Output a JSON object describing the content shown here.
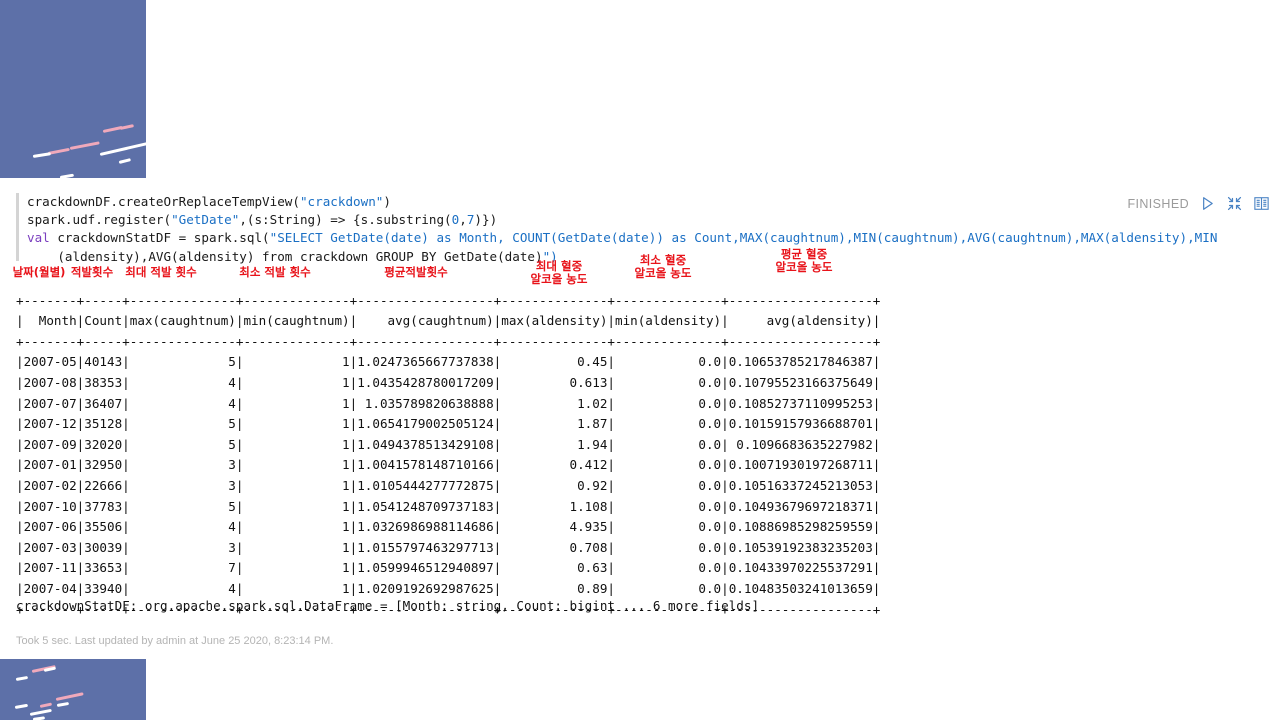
{
  "notebook": {
    "code_lines": [
      "crackdownDF.createOrReplaceTempView(\"crackdown\")",
      "spark.udf.register(\"GetDate\",(s:String) => {s.substring(0,7)})",
      "val crackdownStatDF = spark.sql(\"SELECT GetDate(date) as Month, COUNT(GetDate(date)) as Count,MAX(caughtnum),MIN(caughtnum),AVG(caughtnum),MAX(aldensity),MIN",
      "    (aldensity),AVG(aldensity) from crackdown GROUP BY GetDate(date)\")"
    ],
    "status_label": "FINISHED",
    "icons": [
      "run-icon",
      "collapse-icon",
      "book-icon"
    ],
    "result_line": "crackdownStatDF: org.apache.spark.sql.DataFrame = [Month: string, Count: bigint ... 6 more fields]",
    "footer": "Took 5 sec. Last updated by admin at June 25 2020, 8:23:14 PM."
  },
  "table": {
    "rule": "+-------+-----+--------------+--------------+------------------+--------------+--------------+-------------------+",
    "header": "|  Month|Count|max(caughtnum)|min(caughtnum)|    avg(caughtnum)|max(aldensity)|min(aldensity)|     avg(aldensity)|",
    "columns": [
      "Month",
      "Count",
      "max(caughtnum)",
      "min(caughtnum)",
      "avg(caughtnum)",
      "max(aldensity)",
      "min(aldensity)",
      "avg(aldensity)"
    ],
    "rows": [
      [
        "2007-05",
        "40143",
        "5",
        "1",
        "1.0247365667737838",
        "0.45",
        "0.0",
        "0.10653785217846387"
      ],
      [
        "2007-08",
        "38353",
        "4",
        "1",
        "1.0435428780017209",
        "0.613",
        "0.0",
        "0.10795523166375649"
      ],
      [
        "2007-07",
        "36407",
        "4",
        "1",
        "1.035789820638888",
        "1.02",
        "0.0",
        "0.10852737110995253"
      ],
      [
        "2007-12",
        "35128",
        "5",
        "1",
        "1.0654179002505124",
        "1.87",
        "0.0",
        "0.10159157936688701"
      ],
      [
        "2007-09",
        "32020",
        "5",
        "1",
        "1.0494378513429108",
        "1.94",
        "0.0",
        "0.1096683635227982"
      ],
      [
        "2007-01",
        "32950",
        "3",
        "1",
        "1.0041578148710166",
        "0.412",
        "0.0",
        "0.10071930197268711"
      ],
      [
        "2007-02",
        "22666",
        "3",
        "1",
        "1.0105444277772875",
        "0.92",
        "0.0",
        "0.10516337245213053"
      ],
      [
        "2007-10",
        "37783",
        "5",
        "1",
        "1.0541248709737183",
        "1.108",
        "0.0",
        "0.10493679697218371"
      ],
      [
        "2007-06",
        "35506",
        "4",
        "1",
        "1.0326986988114686",
        "4.935",
        "0.0",
        "0.10886985298259559"
      ],
      [
        "2007-03",
        "30039",
        "3",
        "1",
        "1.0155797463297713",
        "0.708",
        "0.0",
        "0.10539192383235203"
      ],
      [
        "2007-11",
        "33653",
        "7",
        "1",
        "1.0599946512940897",
        "0.63",
        "0.0",
        "0.10433970225537291"
      ],
      [
        "2007-04",
        "33940",
        "4",
        "1",
        "1.0209192692987625",
        "0.89",
        "0.0",
        "0.10483503241013659"
      ]
    ],
    "rendered": "+-------+-----+--------------+--------------+------------------+--------------+--------------+-------------------+\n|  Month|Count|max(caughtnum)|min(caughtnum)|    avg(caughtnum)|max(aldensity)|min(aldensity)|     avg(aldensity)|\n+-------+-----+--------------+--------------+------------------+--------------+--------------+-------------------+\n|2007-05|40143|             5|             1|1.0247365667737838|          0.45|           0.0|0.10653785217846387|\n|2007-08|38353|             4|             1|1.0435428780017209|         0.613|           0.0|0.10795523166375649|\n|2007-07|36407|             4|             1| 1.035789820638888|          1.02|           0.0|0.10852737110995253|\n|2007-12|35128|             5|             1|1.0654179002505124|          1.87|           0.0|0.10159157936688701|\n|2007-09|32020|             5|             1|1.0494378513429108|          1.94|           0.0| 0.1096683635227982|\n|2007-01|32950|             3|             1|1.0041578148710166|         0.412|           0.0|0.10071930197268711|\n|2007-02|22666|             3|             1|1.0105444277772875|          0.92|           0.0|0.10516337245213053|\n|2007-10|37783|             5|             1|1.0541248709737183|         1.108|           0.0|0.10493679697218371|\n|2007-06|35506|             4|             1|1.0326986988114686|         4.935|           0.0|0.10886985298259559|\n|2007-03|30039|             3|             1|1.0155797463297713|         0.708|           0.0|0.10539192383235203|\n|2007-11|33653|             7|             1|1.0599946512940897|          0.63|           0.0|0.10433970225537291|\n|2007-04|33940|             4|             1|1.0209192692987625|          0.89|           0.0|0.10483503241013659|\n+-------+-----+--------------+--------------+------------------+--------------+--------------+-------------------+"
  },
  "annotations": {
    "color": "#e8131a",
    "items": [
      {
        "text": "날짜(월별)",
        "target_column": "Month"
      },
      {
        "text": "적발횟수",
        "target_column": "Count"
      },
      {
        "text": "최대 적발 횟수",
        "target_column": "max(caughtnum)"
      },
      {
        "text": "최소 적발 횟수",
        "target_column": "min(caughtnum)"
      },
      {
        "text": "평균적발횟수",
        "target_column": "avg(caughtnum)"
      },
      {
        "text": "최대 혈중\n알코올 농도",
        "target_column": "max(aldensity)"
      },
      {
        "text": "최소 혈중\n알코올 농도",
        "target_column": "min(aldensity)"
      },
      {
        "text": "평균 혈중\n알코올 농도",
        "target_column": "avg(aldensity)"
      }
    ]
  },
  "decor": {
    "panel_color": "#5d70a8"
  }
}
